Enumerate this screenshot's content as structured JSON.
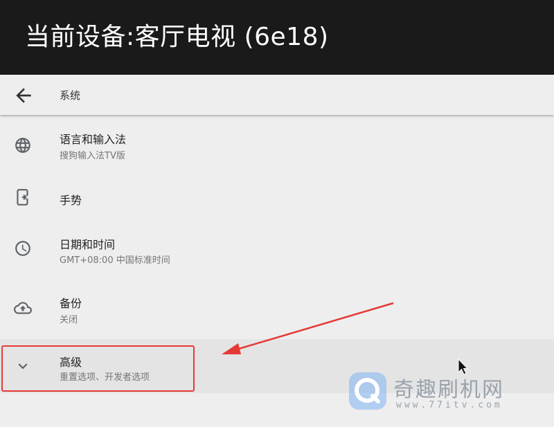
{
  "header": {
    "title": "当前设备:客厅电视 (6e18)"
  },
  "toolbar": {
    "title": "系统",
    "back_icon": "arrow-back-icon"
  },
  "items": [
    {
      "primary": "语言和输入法",
      "secondary": "搜狗输入法TV版",
      "icon": "globe-icon"
    },
    {
      "primary": "手势",
      "secondary": "",
      "icon": "phone-gesture-icon"
    },
    {
      "primary": "日期和时间",
      "secondary": "GMT+08:00 中国标准时间",
      "icon": "clock-icon"
    },
    {
      "primary": "备份",
      "secondary": "关闭",
      "icon": "cloud-upload-icon"
    },
    {
      "primary": "高级",
      "secondary": "重置选项、开发者选项",
      "icon": "chevron-down-icon"
    }
  ],
  "annotation": {
    "color": "#e53935"
  },
  "watermark": {
    "brand": "奇趣刷机网",
    "url": "www.77itv.com"
  },
  "colors": {
    "header_bg": "#1a1a1a",
    "list_bg": "#eeeeee",
    "primary_text": "#212121",
    "secondary_text": "#757575"
  }
}
